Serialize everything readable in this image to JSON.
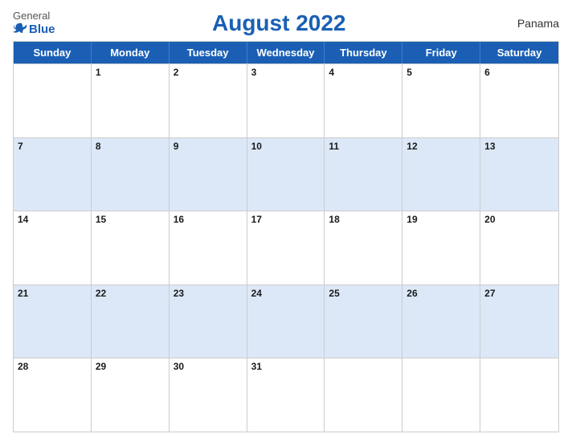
{
  "header": {
    "logo_general": "General",
    "logo_blue": "Blue",
    "title": "August 2022",
    "country": "Panama"
  },
  "calendar": {
    "days_of_week": [
      "Sunday",
      "Monday",
      "Tuesday",
      "Wednesday",
      "Thursday",
      "Friday",
      "Saturday"
    ],
    "weeks": [
      [
        {
          "num": "",
          "empty": true,
          "shaded": false
        },
        {
          "num": "1",
          "empty": false,
          "shaded": false
        },
        {
          "num": "2",
          "empty": false,
          "shaded": false
        },
        {
          "num": "3",
          "empty": false,
          "shaded": false
        },
        {
          "num": "4",
          "empty": false,
          "shaded": false
        },
        {
          "num": "5",
          "empty": false,
          "shaded": false
        },
        {
          "num": "6",
          "empty": false,
          "shaded": false
        }
      ],
      [
        {
          "num": "7",
          "empty": false,
          "shaded": true
        },
        {
          "num": "8",
          "empty": false,
          "shaded": true
        },
        {
          "num": "9",
          "empty": false,
          "shaded": true
        },
        {
          "num": "10",
          "empty": false,
          "shaded": true
        },
        {
          "num": "11",
          "empty": false,
          "shaded": true
        },
        {
          "num": "12",
          "empty": false,
          "shaded": true
        },
        {
          "num": "13",
          "empty": false,
          "shaded": true
        }
      ],
      [
        {
          "num": "14",
          "empty": false,
          "shaded": false
        },
        {
          "num": "15",
          "empty": false,
          "shaded": false
        },
        {
          "num": "16",
          "empty": false,
          "shaded": false
        },
        {
          "num": "17",
          "empty": false,
          "shaded": false
        },
        {
          "num": "18",
          "empty": false,
          "shaded": false
        },
        {
          "num": "19",
          "empty": false,
          "shaded": false
        },
        {
          "num": "20",
          "empty": false,
          "shaded": false
        }
      ],
      [
        {
          "num": "21",
          "empty": false,
          "shaded": true
        },
        {
          "num": "22",
          "empty": false,
          "shaded": true
        },
        {
          "num": "23",
          "empty": false,
          "shaded": true
        },
        {
          "num": "24",
          "empty": false,
          "shaded": true
        },
        {
          "num": "25",
          "empty": false,
          "shaded": true
        },
        {
          "num": "26",
          "empty": false,
          "shaded": true
        },
        {
          "num": "27",
          "empty": false,
          "shaded": true
        }
      ],
      [
        {
          "num": "28",
          "empty": false,
          "shaded": false
        },
        {
          "num": "29",
          "empty": false,
          "shaded": false
        },
        {
          "num": "30",
          "empty": false,
          "shaded": false
        },
        {
          "num": "31",
          "empty": false,
          "shaded": false
        },
        {
          "num": "",
          "empty": true,
          "shaded": false
        },
        {
          "num": "",
          "empty": true,
          "shaded": false
        },
        {
          "num": "",
          "empty": true,
          "shaded": false
        }
      ]
    ]
  }
}
